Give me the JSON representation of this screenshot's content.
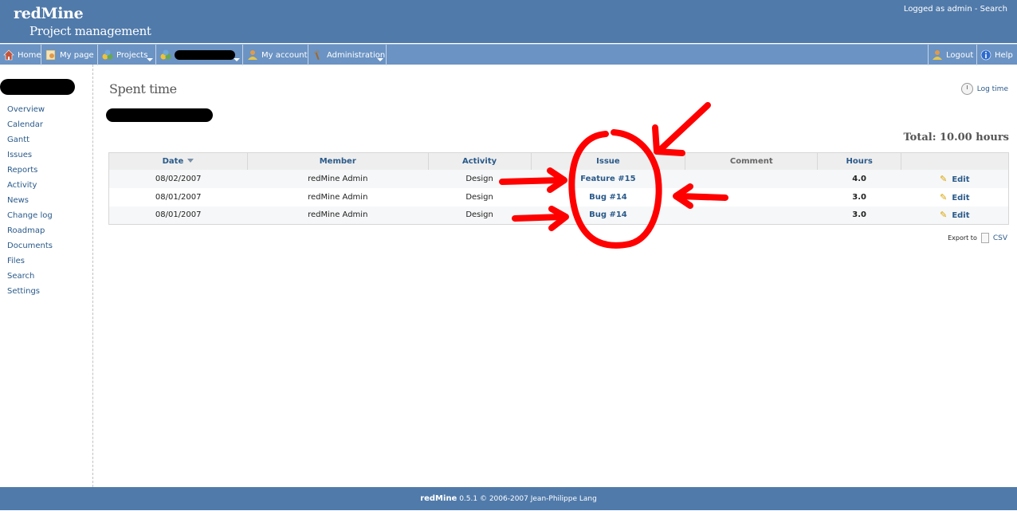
{
  "header": {
    "app_title": "redMine",
    "app_subtitle": "Project management",
    "logged_as": "Logged as admin",
    "separator": " - ",
    "search_link": "Search"
  },
  "menu": {
    "home": "Home",
    "my_page": "My page",
    "projects": "Projects",
    "my_account": "My account",
    "administration": "Administration",
    "logout": "Logout",
    "help": "Help"
  },
  "sidebar": {
    "items": [
      {
        "label": "Overview"
      },
      {
        "label": "Calendar"
      },
      {
        "label": "Gantt"
      },
      {
        "label": "Issues"
      },
      {
        "label": "Reports"
      },
      {
        "label": "Activity"
      },
      {
        "label": "News"
      },
      {
        "label": "Change log"
      },
      {
        "label": "Roadmap"
      },
      {
        "label": "Documents"
      },
      {
        "label": "Files"
      },
      {
        "label": "Search"
      },
      {
        "label": "Settings"
      }
    ]
  },
  "content": {
    "title": "Spent time",
    "log_time": "Log time",
    "total": "Total: 10.00 hours"
  },
  "table": {
    "headers": {
      "date": "Date",
      "member": "Member",
      "activity": "Activity",
      "issue": "Issue",
      "comment": "Comment",
      "hours": "Hours"
    },
    "rows": [
      {
        "date": "08/02/2007",
        "member": "redMine Admin",
        "activity": "Design",
        "issue": "Feature #15",
        "comment": "",
        "hours": "4.0",
        "action": "Edit"
      },
      {
        "date": "08/01/2007",
        "member": "redMine Admin",
        "activity": "Design",
        "issue": "Bug #14",
        "comment": "",
        "hours": "3.0",
        "action": "Edit"
      },
      {
        "date": "08/01/2007",
        "member": "redMine Admin",
        "activity": "Design",
        "issue": "Bug #14",
        "comment": "",
        "hours": "3.0",
        "action": "Edit"
      }
    ]
  },
  "export": {
    "label": "Export to",
    "csv": "CSV"
  },
  "footer": {
    "app": "redMine",
    "text": " 0.5.1 © 2006-2007 Jean-Philippe Lang"
  },
  "colors": {
    "header_bg": "#507aaa",
    "menu_bg": "#6b93c3",
    "link": "#2a5a8a",
    "annotation": "#ff0000"
  }
}
